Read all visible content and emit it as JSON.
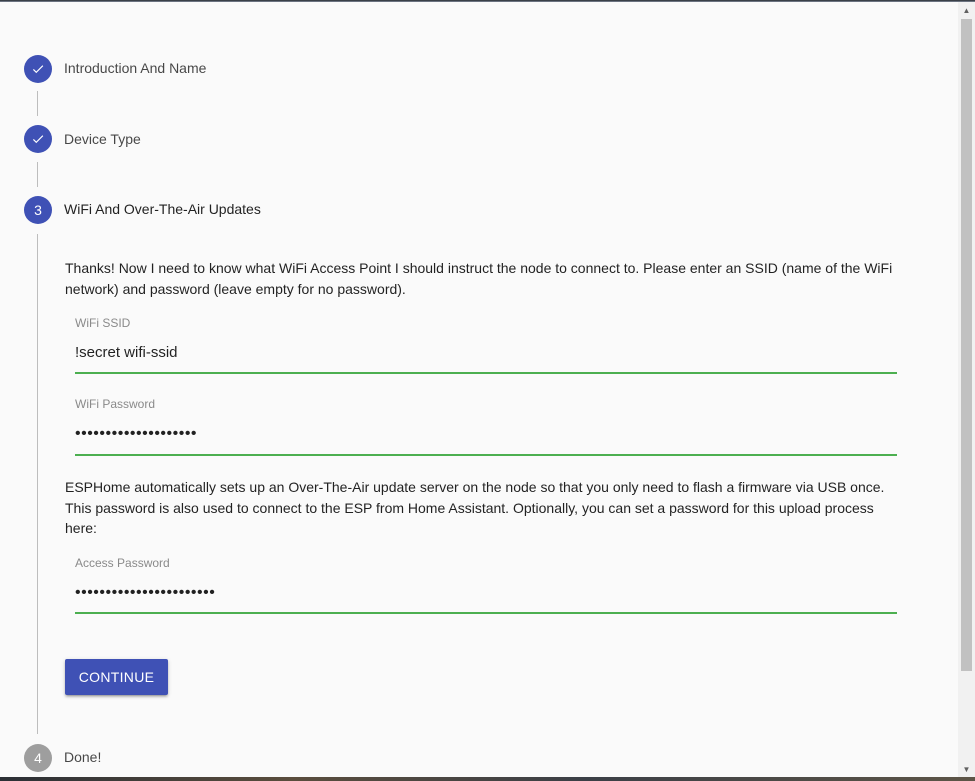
{
  "stepper": {
    "steps": [
      {
        "number": "1",
        "title": "Introduction And Name",
        "status": "completed",
        "icon": "check-icon"
      },
      {
        "number": "2",
        "title": "Device Type",
        "status": "completed",
        "icon": "check-icon"
      },
      {
        "number": "3",
        "title": "WiFi And Over-The-Air Updates",
        "status": "active"
      },
      {
        "number": "4",
        "title": "Done!",
        "status": "pending"
      }
    ]
  },
  "wifi_step": {
    "intro_text": "Thanks! Now I need to know what WiFi Access Point I should instruct the node to connect to. Please enter an SSID (name of the WiFi network) and password (leave empty for no password).",
    "ssid": {
      "label": "WiFi SSID",
      "value": "!secret wifi-ssid"
    },
    "password": {
      "label": "WiFi Password",
      "value": "••••••••••••••••••••"
    },
    "ota_text": "ESPHome automatically sets up an Over-The-Air update server on the node so that you only need to flash a firmware via USB once. This password is also used to connect to the ESP from Home Assistant. Optionally, you can set a password for this upload process here:",
    "access_password": {
      "label": "Access Password",
      "value": "•••••••••••••••••••••••"
    },
    "continue_label": "CONTINUE"
  },
  "colors": {
    "primary": "#3f51b5",
    "inactive_step": "#9e9e9e",
    "valid_underline": "#4caf50"
  }
}
